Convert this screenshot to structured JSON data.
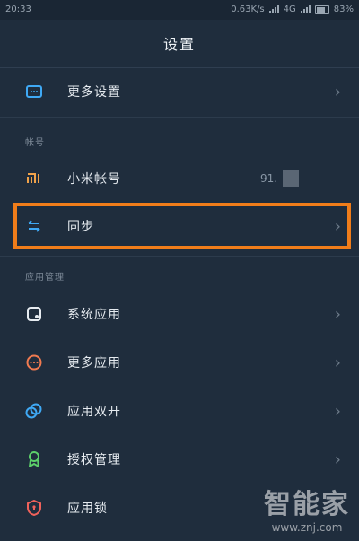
{
  "status": {
    "time": "20:33",
    "speed": "0.63K/s",
    "network": "4G",
    "battery": "83%"
  },
  "header": {
    "title": "设置"
  },
  "rows": {
    "more_settings": {
      "label": "更多设置",
      "icon": "more-settings-icon"
    },
    "mi_account": {
      "label": "小米帐号",
      "icon": "mi-logo-icon",
      "value": "91."
    },
    "sync": {
      "label": "同步",
      "icon": "sync-icon"
    },
    "system_apps": {
      "label": "系统应用",
      "icon": "system-apps-icon"
    },
    "more_apps": {
      "label": "更多应用",
      "icon": "more-apps-icon"
    },
    "dual_apps": {
      "label": "应用双开",
      "icon": "dual-apps-icon"
    },
    "permissions": {
      "label": "授权管理",
      "icon": "permissions-icon"
    },
    "app_lock": {
      "label": "应用锁",
      "icon": "app-lock-icon"
    }
  },
  "sections": {
    "account": "帐号",
    "app_management": "应用管理"
  },
  "chevron": "›",
  "watermark": {
    "main": "智能家",
    "url": "www.znj.com"
  },
  "colors": {
    "background": "#1f2d3d",
    "highlight": "#f07d1a",
    "blue_icon": "#3fa9f5",
    "orange_icon": "#f0a24a",
    "green_icon": "#5ccf6a",
    "red_icon": "#f0625b"
  }
}
